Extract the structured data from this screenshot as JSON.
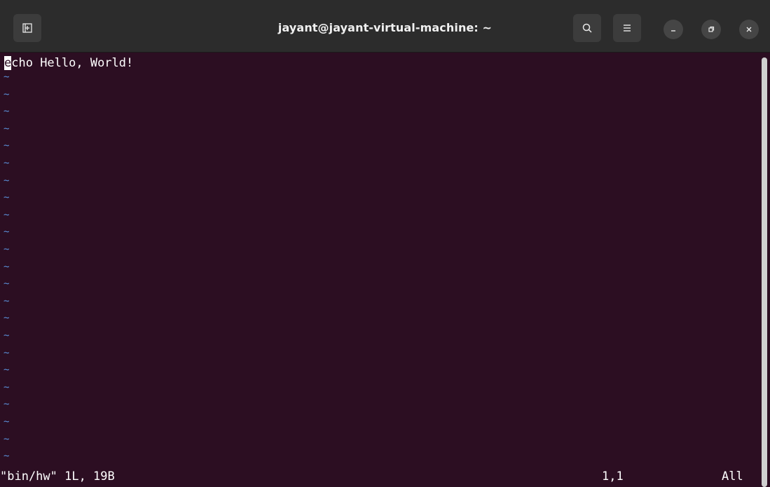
{
  "window": {
    "title": "jayant@jayant-virtual-machine: ~"
  },
  "titlebar_icons": {
    "new_tab": "new-tab-icon",
    "search": "search-icon",
    "menu": "hamburger-menu-icon",
    "minimize": "minimize-icon",
    "restore": "restore-icon",
    "close": "close-icon"
  },
  "editor": {
    "cursor_char": "e",
    "line1_rest": "cho Hello, World!",
    "tilde": "~",
    "empty_line_count": 23
  },
  "statusline": {
    "file_info": "\"bin/hw\" 1L, 19B",
    "position": "1,1",
    "scroll": "All"
  },
  "colors": {
    "terminal_bg": "#2c0e22",
    "titlebar_bg": "#2c2c2c",
    "tilde": "#5a8fd8",
    "text": "#ffffff"
  }
}
